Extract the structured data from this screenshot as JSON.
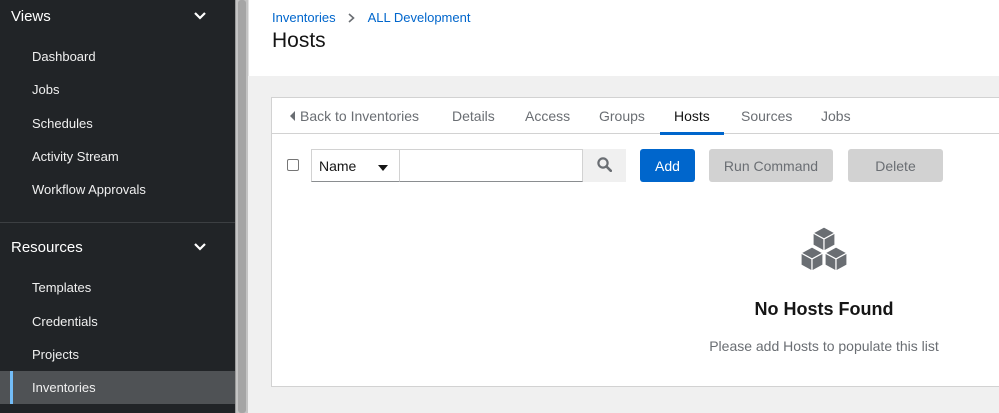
{
  "sidebar": {
    "groups": [
      {
        "label": "Views",
        "items": [
          "Dashboard",
          "Jobs",
          "Schedules",
          "Activity Stream",
          "Workflow Approvals"
        ]
      },
      {
        "label": "Resources",
        "items": [
          "Templates",
          "Credentials",
          "Projects",
          "Inventories"
        ]
      }
    ],
    "active_item": "Inventories"
  },
  "breadcrumb": [
    "Inventories",
    "ALL Development"
  ],
  "page_title": "Hosts",
  "tabs": [
    "Back to Inventories",
    "Details",
    "Access",
    "Groups",
    "Hosts",
    "Sources",
    "Jobs"
  ],
  "active_tab": "Hosts",
  "toolbar": {
    "filter_selected": "Name",
    "search_value": "",
    "add_label": "Add",
    "run_command_label": "Run Command",
    "delete_label": "Delete"
  },
  "empty_state": {
    "title": "No Hosts Found",
    "body": "Please add Hosts to populate this list"
  },
  "colors": {
    "sidebar_bg": "#212427",
    "accent": "#0066cc",
    "active_nav_bar": "#73bcf7"
  }
}
